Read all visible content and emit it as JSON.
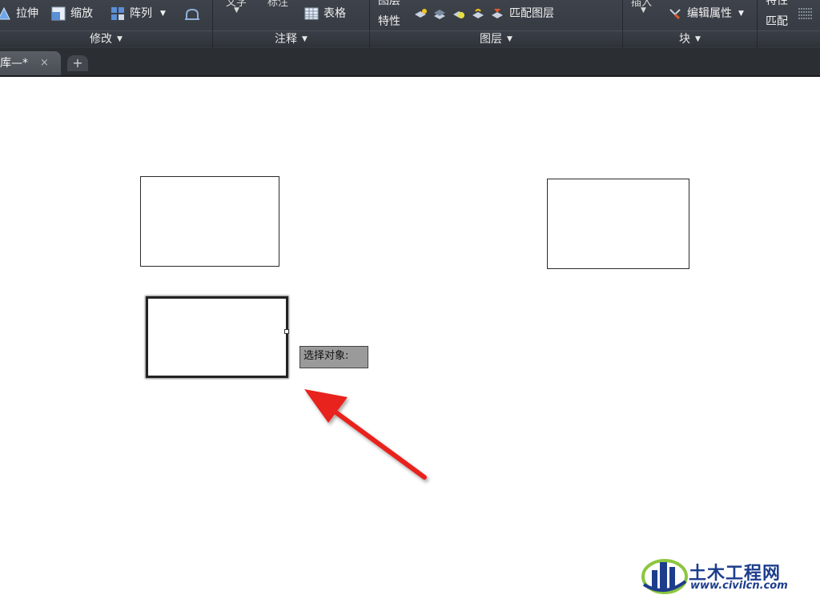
{
  "ribbon": {
    "modify": {
      "title": "修改",
      "stretch": "拉伸",
      "scale": "缩放",
      "array": "阵列"
    },
    "annotation": {
      "title": "注释",
      "text": "文字",
      "dimension": "标注",
      "table": "表格"
    },
    "layers": {
      "title": "图层",
      "layer_props_top": "图层",
      "layer_props_bottom": "特性",
      "match_layer": "匹配图层"
    },
    "block": {
      "title": "块",
      "insert": "插入",
      "edit_attributes": "编辑属性"
    },
    "properties": {
      "top": "特性",
      "bottom": "匹配"
    }
  },
  "tabs": {
    "doc_label": "库—*",
    "close": "×",
    "add": "+"
  },
  "canvas": {
    "tooltip": "选择对象:"
  },
  "watermark": {
    "title": "土木工程网",
    "url": "www.civilcn.com"
  },
  "colors": {
    "ribbon_bg": "#393d44",
    "arrow": "#e8231f",
    "watermark_blue": "#1d3d8c",
    "watermark_green": "#8cc63f"
  }
}
